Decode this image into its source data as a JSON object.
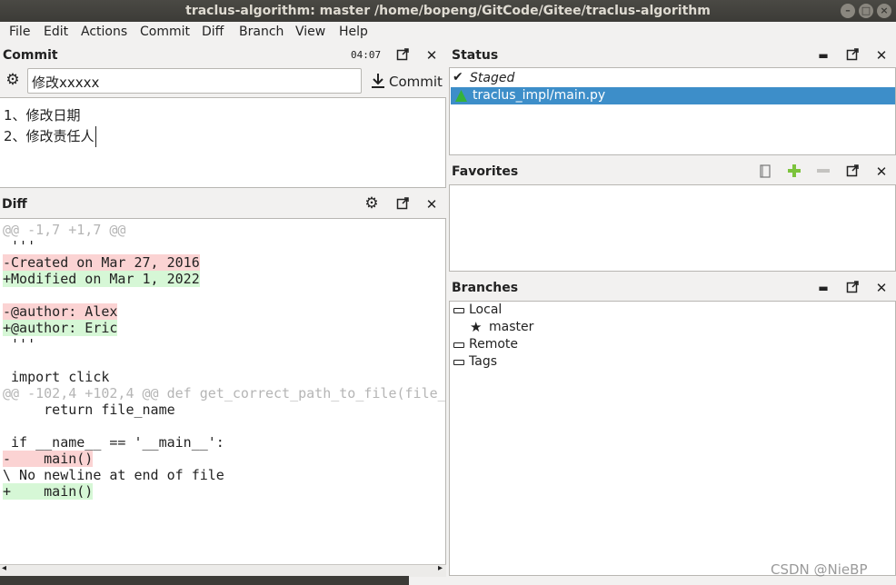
{
  "window": {
    "title": "traclus-algorithm: master /home/bopeng/GitCode/Gitee/traclus-algorithm"
  },
  "menu": [
    "File",
    "Edit",
    "Actions",
    "Commit",
    "Diff",
    "Branch",
    "View",
    "Help"
  ],
  "commit": {
    "title": "Commit",
    "time": "04:07",
    "summary": "修改xxxxx",
    "button_label": "Commit",
    "message_lines": [
      "1、修改日期",
      "2、修改责任人"
    ]
  },
  "diff": {
    "title": "Diff",
    "lines": [
      {
        "text": "@@ -1,7 +1,7 @@",
        "kind": "hunk"
      },
      {
        "text": " '''",
        "kind": "ctx"
      },
      {
        "text": "-Created on Mar 27, 2016",
        "kind": "rm"
      },
      {
        "text": "+Modified on Mar 1, 2022",
        "kind": "ad"
      },
      {
        "text": "",
        "kind": "ctx"
      },
      {
        "text": "-@author: Alex",
        "kind": "rm"
      },
      {
        "text": "+@author: Eric",
        "kind": "ad"
      },
      {
        "text": " '''",
        "kind": "ctx"
      },
      {
        "text": "",
        "kind": "ctx"
      },
      {
        "text": " import click",
        "kind": "ctx"
      },
      {
        "text": "@@ -102,4 +102,4 @@ def get_correct_path_to_file(file_",
        "kind": "hunk"
      },
      {
        "text": "     return file_name",
        "kind": "ctx"
      },
      {
        "text": "",
        "kind": "ctx"
      },
      {
        "text": " if __name__ == '__main__':",
        "kind": "ctx"
      },
      {
        "text": "-    main()",
        "kind": "rm"
      },
      {
        "text": "\\ No newline at end of file",
        "kind": "ctx"
      },
      {
        "text": "+    main()",
        "kind": "ad"
      }
    ],
    "colors": {
      "removed": "#fbd3d3",
      "added": "#d6f7d6",
      "hunk": "#b5b5b5"
    }
  },
  "status": {
    "title": "Status",
    "section": "Staged",
    "file": "traclus_impl/main.py",
    "selection_color": "#3d8ec9"
  },
  "favorites": {
    "title": "Favorites"
  },
  "branches": {
    "title": "Branches",
    "local": "Local",
    "current": "master",
    "remote": "Remote",
    "tags": "Tags"
  },
  "watermark": "CSDN @NieBP"
}
